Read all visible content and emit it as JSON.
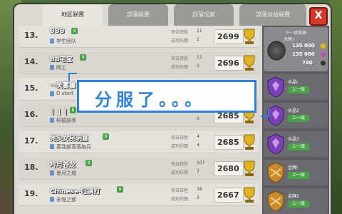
{
  "tabs": [
    {
      "label": "地区联赛",
      "active": true
    },
    {
      "label": "部落联赛",
      "active": false
    },
    {
      "label": "部落玩家",
      "active": false
    },
    {
      "label": "部落对战联赛",
      "active": false
    }
  ],
  "close_label": "X",
  "row_labels": {
    "attack": "攻击获胜",
    "defense": "成功防御"
  },
  "rows": [
    {
      "rank": "13.",
      "name": "BBB",
      "level": "9",
      "clan": "学生团队",
      "attack": "11",
      "defense": "2",
      "trophies": "2699"
    },
    {
      "rank": "14.",
      "name": "BB宅宝",
      "level": "9",
      "clan": "网工",
      "attack": "11",
      "defense": "0",
      "trophies": "2696"
    },
    {
      "rank": "15.",
      "name": "一笑雾霾",
      "level": "8",
      "clan": "D start",
      "attack": "",
      "defense": "",
      "trophies": ""
    },
    {
      "rank": "16.",
      "name": "丨丨丨",
      "level": "8",
      "clan": "轩辕部落",
      "attack": "",
      "defense": "0",
      "trophies": "2685"
    },
    {
      "rank": "17.",
      "name": "秃头女民明星",
      "level": "9",
      "clan": "莱我部落落格兵",
      "attack": "4",
      "defense": "4",
      "trophies": "2685"
    },
    {
      "rank": "18.",
      "name": "吟月苍龙",
      "level": "9",
      "clan": "墨月之城",
      "attack": "107",
      "defense": "7",
      "trophies": "2680"
    },
    {
      "rank": "19.",
      "name": "Chinese-吐演打",
      "level": "9",
      "clan": "永恒之都",
      "attack": "38",
      "defense": "3",
      "trophies": "2667"
    }
  ],
  "sidebar": {
    "next_league_label": "下一级联赛",
    "league_name": "大师 I",
    "stats": [
      {
        "value": "135 000",
        "color": "#e6b800"
      },
      {
        "value": "135 000",
        "color": "#c04ab8"
      },
      {
        "value": "740",
        "color": "#333333"
      }
    ],
    "leagues": [
      {
        "name": "水晶I",
        "action": "上一级",
        "color": "#7b3fb8"
      },
      {
        "name": "水晶2",
        "action": "上一级",
        "color": "#7b3fb8"
      },
      {
        "name": "水晶3",
        "action": "上一级",
        "color": "#7b3fb8"
      },
      {
        "name": "金牌I",
        "action": "上一级",
        "color": "#c98a2c"
      },
      {
        "name": "金牌2",
        "action": "上一级",
        "color": "#c98a2c"
      }
    ]
  },
  "overlay": {
    "text": "分服了。。。"
  }
}
